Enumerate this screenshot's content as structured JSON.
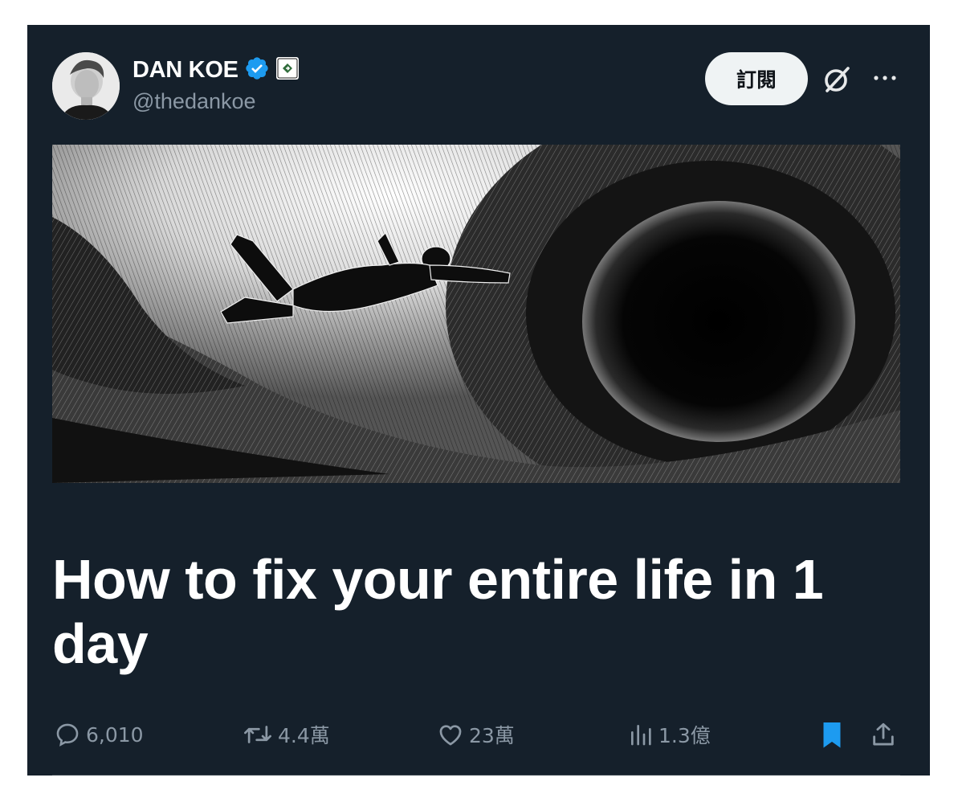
{
  "author": {
    "name": "DAN KOE",
    "handle": "@thedankoe"
  },
  "header": {
    "subscribe_label": "訂閱"
  },
  "article": {
    "title": "How to fix your entire life in 1 day"
  },
  "actions": {
    "replies": "6,010",
    "reposts": "4.4萬",
    "likes": "23萬",
    "views": "1.3億"
  },
  "colors": {
    "background": "#15202b",
    "text": "#ffffff",
    "muted": "#8b98a5",
    "verified": "#1d9bf0",
    "bookmark": "#1d9bf0"
  },
  "icons": [
    "verified-badge-icon",
    "affiliate-badge-icon",
    "grok-icon",
    "more-icon",
    "reply-icon",
    "repost-icon",
    "like-icon",
    "views-icon",
    "bookmark-icon",
    "share-icon"
  ]
}
